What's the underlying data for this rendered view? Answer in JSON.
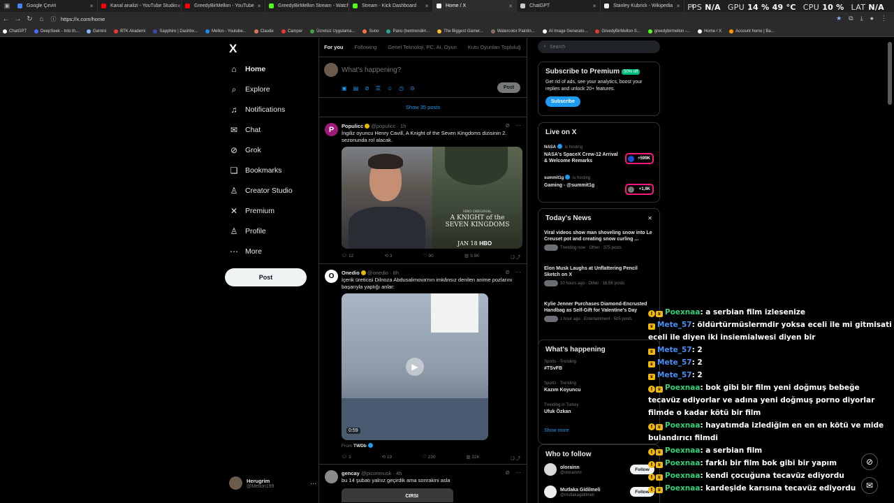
{
  "browser": {
    "tabs": [
      {
        "title": "Google Çeviri",
        "color": "#4285f4"
      },
      {
        "title": "Kanal analizi - YouTube Studio",
        "color": "#ff0000"
      },
      {
        "title": "GreedyBirMellon - YouTube",
        "color": "#ff0000"
      },
      {
        "title": "GreedyBirMellon Stream - Watch",
        "color": "#53fc18"
      },
      {
        "title": "Stream - Kick Dashboard",
        "color": "#53fc18"
      },
      {
        "title": "Home / X",
        "color": "#ffffff",
        "active": true
      },
      {
        "title": "ChatGPT",
        "color": "#cccccc"
      },
      {
        "title": "Stanley Kubrick - Wikipedia",
        "color": "#eeeeee"
      }
    ],
    "new_tab": "+",
    "url": "https://x.com/home",
    "bookmarks": [
      {
        "label": "ChatGPT",
        "color": "#ffffff"
      },
      {
        "label": "DeepSeek - Into th...",
        "color": "#4d6bfe"
      },
      {
        "label": "Gemini",
        "color": "#8ab4f8"
      },
      {
        "label": "BTK Akademi",
        "color": "#e53935"
      },
      {
        "label": "Sapphire | Dashbo...",
        "color": "#3949ab"
      },
      {
        "label": "Mellon - Youtube...",
        "color": "#1e88e5"
      },
      {
        "label": "Claude",
        "color": "#d97757"
      },
      {
        "label": "Camper",
        "color": "#e53935"
      },
      {
        "label": "Ücretsiz Uygulama...",
        "color": "#43a047"
      },
      {
        "label": "Suno",
        "color": "#ff7043"
      },
      {
        "label": "Pano (bentrendim...",
        "color": "#26a69a"
      },
      {
        "label": "The Biggest Gamer...",
        "color": "#fbc02d"
      },
      {
        "label": "Watercolor Paintin...",
        "color": "#8d6e63"
      },
      {
        "label": "AI Image Generato...",
        "color": "#ffffff"
      },
      {
        "label": "GreedyBirMellon S...",
        "color": "#e53935"
      },
      {
        "label": "greedybirmellon -...",
        "color": "#53fc18"
      },
      {
        "label": "Home / X",
        "color": "#ffffff"
      },
      {
        "label": "Account home | Ba...",
        "color": "#ff9800"
      }
    ]
  },
  "hud": {
    "fps_label": "FPS",
    "fps": "N/A",
    "gpu_label": "GPU",
    "gpu": "14 % 49 °C",
    "cpu_label": "CPU",
    "cpu": "10 %",
    "lat_label": "LAT",
    "lat": "N/A"
  },
  "nav": {
    "logo": "X",
    "items": [
      {
        "label": "Home",
        "icon": "home-icon",
        "glyph": "⌂"
      },
      {
        "label": "Explore",
        "icon": "search-icon",
        "glyph": "⌕"
      },
      {
        "label": "Notifications",
        "icon": "bell-icon",
        "glyph": "♫"
      },
      {
        "label": "Chat",
        "icon": "envelope-icon",
        "glyph": "✉"
      },
      {
        "label": "Grok",
        "icon": "grok-icon",
        "glyph": "⊘"
      },
      {
        "label": "Bookmarks",
        "icon": "bookmark-icon",
        "glyph": "❏"
      },
      {
        "label": "Creator Studio",
        "icon": "creator-icon",
        "glyph": "♙"
      },
      {
        "label": "Premium",
        "icon": "x-icon",
        "glyph": "✕"
      },
      {
        "label": "Profile",
        "icon": "person-icon",
        "glyph": "♙"
      },
      {
        "label": "More",
        "icon": "more-icon",
        "glyph": "⋯"
      }
    ],
    "post_label": "Post",
    "account": {
      "name": "Herugrim",
      "handle": "@Mellon199",
      "more": "···"
    }
  },
  "feed": {
    "tabs": [
      "For you",
      "Following",
      "Genel Teknoloji, PC, AI, Oyun",
      "Kutu Oyunları Topluluğ"
    ],
    "composer_placeholder": "What's happening?",
    "post_label": "Post",
    "show_posts": "Show 35 posts",
    "tweets": [
      {
        "name": "Populicc",
        "handle": "@populicc · 1h",
        "text": "İngiliz oyuncu Henry Cavill, A Knight of the Seven Kingdoms dizisinin 2. sezonunda rol alacak.",
        "poster_top": "HBO ORIGINAL",
        "poster_title": "A KNIGHT of the SEVEN KINGDOMS",
        "poster_date": "JAN 18",
        "poster_brand": "HBO",
        "replies": "12",
        "reposts": "3",
        "likes": "90",
        "views": "9,9K"
      },
      {
        "name": "Onedio",
        "handle": "@onedio · 8h",
        "text": "İçerik üreticisi Dilnoza Abdusalimova'nın imkânsız denilen anime pozlarını başarıyla yaptığı anlar:",
        "video_time": "0:59",
        "from_label": "From",
        "from_source": "TWDb",
        "replies": "3",
        "reposts": "19",
        "likes": "230",
        "views": "32K"
      },
      {
        "name": "gencay",
        "handle": "@piconmusk · 4h",
        "text": "bu 14 şubatı yalnız geçirdik ama sonrakini asla",
        "image_text": "CIRSI"
      }
    ]
  },
  "sidebar": {
    "search_placeholder": "Search",
    "premium": {
      "title": "Subscribe to Premium",
      "badge": "50% off",
      "body": "Get rid of ads, see your analytics, boost your replies and unlock 20+ features.",
      "button": "Subscribe"
    },
    "live": {
      "title": "Live on X",
      "items": [
        {
          "host": "NASA",
          "status": "is hosting",
          "title": "NASA's SpaceX Crew-12 Arrival & Welcome Remarks",
          "count": "+599K"
        },
        {
          "host": "summit1g",
          "status": "is hosting",
          "title": "Gaming - @summit1g",
          "count": "+1,9K"
        }
      ]
    },
    "news": {
      "title": "Today's News",
      "close": "✕",
      "items": [
        {
          "headline": "Viral videos show man shoveling snow into Le Creuset pot and creating snow curling ...",
          "meta": "Trending now · Other · 375 posts"
        },
        {
          "headline": "Elon Musk Laughs at Unflattering Pencil Sketch on X",
          "meta": "10 hours ago · Other · 16.5K posts"
        },
        {
          "headline": "Kylie Jenner Purchases Diamond-Encrusted Handbag as Self-Gift for Valentine's Day",
          "meta": "1 hour ago · Entertainment · 505 posts"
        }
      ]
    },
    "happening": {
      "title": "What's happening",
      "items": [
        {
          "context": "Sports · Trending",
          "topic": "#TSvFB"
        },
        {
          "context": "Sports · Trending",
          "topic": "Kazım Koyuncu"
        },
        {
          "context": "Trending in Turkey",
          "topic": "Ufuk Özkan"
        }
      ],
      "show_more": "Show more"
    },
    "who_to_follow": {
      "title": "Who to follow",
      "items": [
        {
          "name": "olorainn",
          "handle": "@olorainnn",
          "button": "Follow"
        },
        {
          "name": "Mutlaka Gidilmeli",
          "handle": "@mutlakagidilmeli",
          "button": "Follow"
        }
      ]
    }
  },
  "chat": [
    {
      "user": "Poexnaa",
      "color": "green",
      "msg": ": a serbian film izlesenize",
      "badges": 2
    },
    {
      "user": "Mete_57",
      "color": "blue",
      "msg": ": öldürtürmüslermdir yoksa eceli ile mi gitmisati eceli ile diyen iki insiemialwesi diyen bir",
      "badges": 1
    },
    {
      "user": "Mete_57",
      "color": "blue",
      "msg": ": 2",
      "badges": 1
    },
    {
      "user": "Mete_57",
      "color": "blue",
      "msg": ": 2",
      "badges": 1
    },
    {
      "user": "Mete_57",
      "color": "blue",
      "msg": ": 2",
      "badges": 1
    },
    {
      "user": "Poexnaa",
      "color": "green",
      "msg": ": bok gibi bir film yeni doğmuş bebeğe tecavüz ediyorlar ve adına yeni doğmuş porno diyorlar filmde o kadar kötü bir film",
      "badges": 2
    },
    {
      "user": "Poexnaa",
      "color": "green",
      "msg": ": hayatımda izlediğim en en en kötü ve mide bulandırıcı filmdi",
      "badges": 2
    },
    {
      "user": "Poexnaa",
      "color": "green",
      "msg": ": a serbian film",
      "badges": 2
    },
    {
      "user": "Poexnaa",
      "color": "green",
      "msg": ": farklı bir film bok gibi bir yapım",
      "badges": 2
    },
    {
      "user": "Poexnaa",
      "color": "green",
      "msg": ": kendi çocuğuna tecavüz ediyordu",
      "badges": 2
    },
    {
      "user": "Poexnaa",
      "color": "green",
      "msg": ": kardeşide karısına tecavüz ediyordu",
      "badges": 2
    }
  ],
  "colors": {
    "accent": "#1d9bf0",
    "live": "#f91880",
    "chat_green": "#35d17a",
    "chat_blue": "#4d8ff5"
  }
}
